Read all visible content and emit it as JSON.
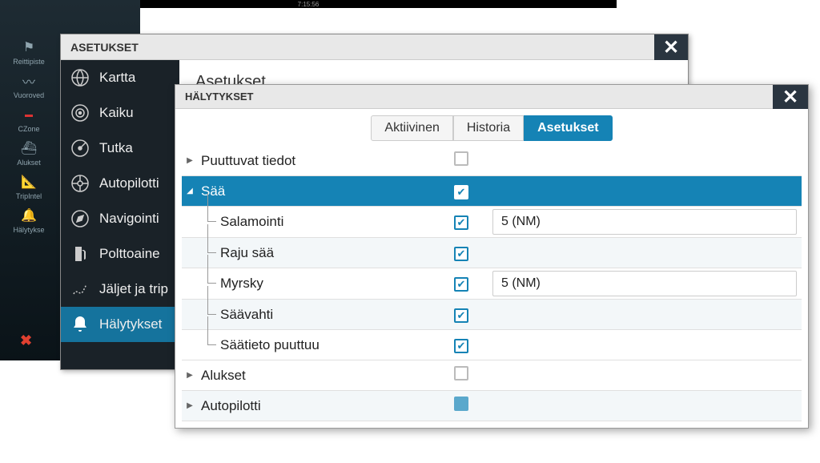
{
  "statusbar": {
    "time": "7:15:56"
  },
  "bg_sidebar": [
    {
      "label": "Reittipiste"
    },
    {
      "label": "Vuoroved"
    },
    {
      "label": "CZone"
    },
    {
      "label": "Alukset"
    },
    {
      "label": "TripIntel"
    },
    {
      "label": "Hälytykse"
    }
  ],
  "win2": {
    "title": "ASETUKSET",
    "content_heading": "Asetukset...",
    "sidebar": [
      {
        "label": "Kartta"
      },
      {
        "label": "Kaiku"
      },
      {
        "label": "Tutka"
      },
      {
        "label": "Autopilotti"
      },
      {
        "label": "Navigointi"
      },
      {
        "label": "Polttoaine"
      },
      {
        "label": "Jäljet ja trip"
      },
      {
        "label": "Hälytykset"
      }
    ]
  },
  "win3": {
    "title": "HÄLYTYKSET",
    "tabs": [
      {
        "label": "Aktiivinen"
      },
      {
        "label": "Historia"
      },
      {
        "label": "Asetukset"
      }
    ],
    "rows": {
      "puuttuvat": "Puuttuvat tiedot",
      "saa": "Sää",
      "salamointi": "Salamointi",
      "salamointi_val": "5 (NM)",
      "raju": "Raju sää",
      "myrsky": "Myrsky",
      "myrsky_val": "5 (NM)",
      "saavahti": "Säävahti",
      "saatieto": "Säätieto puuttuu",
      "alukset": "Alukset",
      "autopilotti": "Autopilotti"
    }
  }
}
